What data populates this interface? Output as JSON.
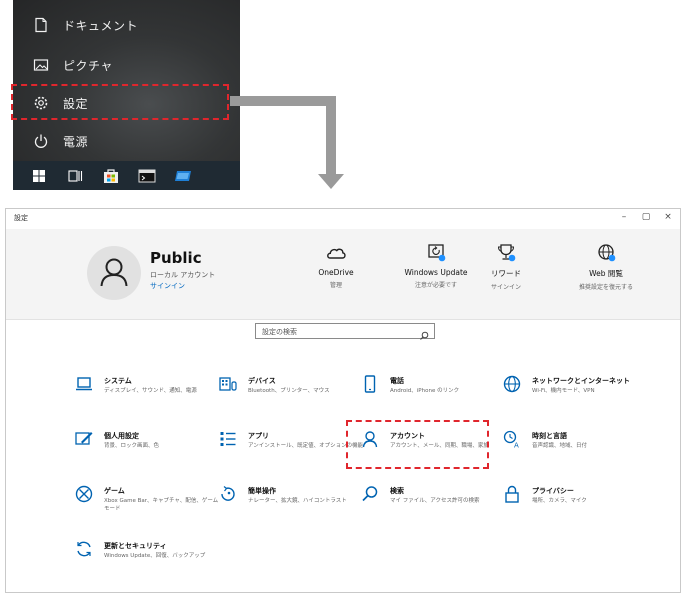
{
  "start_menu": {
    "items": [
      {
        "label": "ドキュメント",
        "icon": "document-icon"
      },
      {
        "label": "ピクチャ",
        "icon": "picture-icon"
      },
      {
        "label": "設定",
        "icon": "gear-icon"
      },
      {
        "label": "電源",
        "icon": "power-icon"
      }
    ],
    "taskbar": [
      "windows-start-icon",
      "task-view-icon",
      "store-icon",
      "terminal-icon",
      "mail-icon"
    ]
  },
  "settings": {
    "window_title": "設定",
    "controls": {
      "minimize": "–",
      "maximize": "▢",
      "close": "×"
    },
    "account": {
      "name": "Public",
      "type": "ローカル アカウント",
      "signin": "サインイン"
    },
    "quick_links": [
      {
        "label": "OneDrive",
        "sub": "管理",
        "icon": "cloud-icon"
      },
      {
        "label": "Windows Update",
        "sub": "注意が必要です",
        "icon": "update-icon"
      },
      {
        "label": "リワード",
        "sub": "サインイン",
        "icon": "trophy-icon"
      },
      {
        "label": "Web 閲覧",
        "sub": "推奨設定を復元する",
        "icon": "globe-icon"
      }
    ],
    "search": {
      "placeholder": "設定の検索"
    },
    "tiles": [
      {
        "title": "システム",
        "desc": "ディスプレイ、サウンド、通知、電源",
        "icon": "laptop-icon"
      },
      {
        "title": "デバイス",
        "desc": "Bluetooth、プリンター、マウス",
        "icon": "keyboard-icon"
      },
      {
        "title": "電話",
        "desc": "Android、iPhone のリンク",
        "icon": "phone-icon"
      },
      {
        "title": "ネットワークとインターネット",
        "desc": "Wi-Fi、機内モード、VPN",
        "icon": "network-icon"
      },
      {
        "title": "個人用設定",
        "desc": "背景、ロック画面、色",
        "icon": "brush-icon"
      },
      {
        "title": "アプリ",
        "desc": "アンインストール、既定値、オプションの機能",
        "icon": "apps-icon"
      },
      {
        "title": "アカウント",
        "desc": "アカウント、メール、同期、職場、家族",
        "icon": "person-icon"
      },
      {
        "title": "時刻と言語",
        "desc": "音声認識、地域、日付",
        "icon": "time-language-icon"
      },
      {
        "title": "ゲーム",
        "desc": "Xbox Game Bar、キャプチャ、配信、ゲーム モード",
        "icon": "xbox-icon"
      },
      {
        "title": "簡単操作",
        "desc": "ナレーター、拡大鏡、ハイコントラスト",
        "icon": "accessibility-icon"
      },
      {
        "title": "検索",
        "desc": "マイ ファイル、アクセス許可の検索",
        "icon": "search-icon"
      },
      {
        "title": "プライバシー",
        "desc": "場所、カメラ、マイク",
        "icon": "lock-icon"
      },
      {
        "title": "更新とセキュリティ",
        "desc": "Windows Update、回復、バックアップ",
        "icon": "sync-icon"
      }
    ]
  },
  "colors": {
    "accent": "#0078d4",
    "highlight": "#e0262d",
    "arrow": "#9a9a9a",
    "start_bg": "#2b2b2b",
    "badge": "#1e90ff"
  }
}
